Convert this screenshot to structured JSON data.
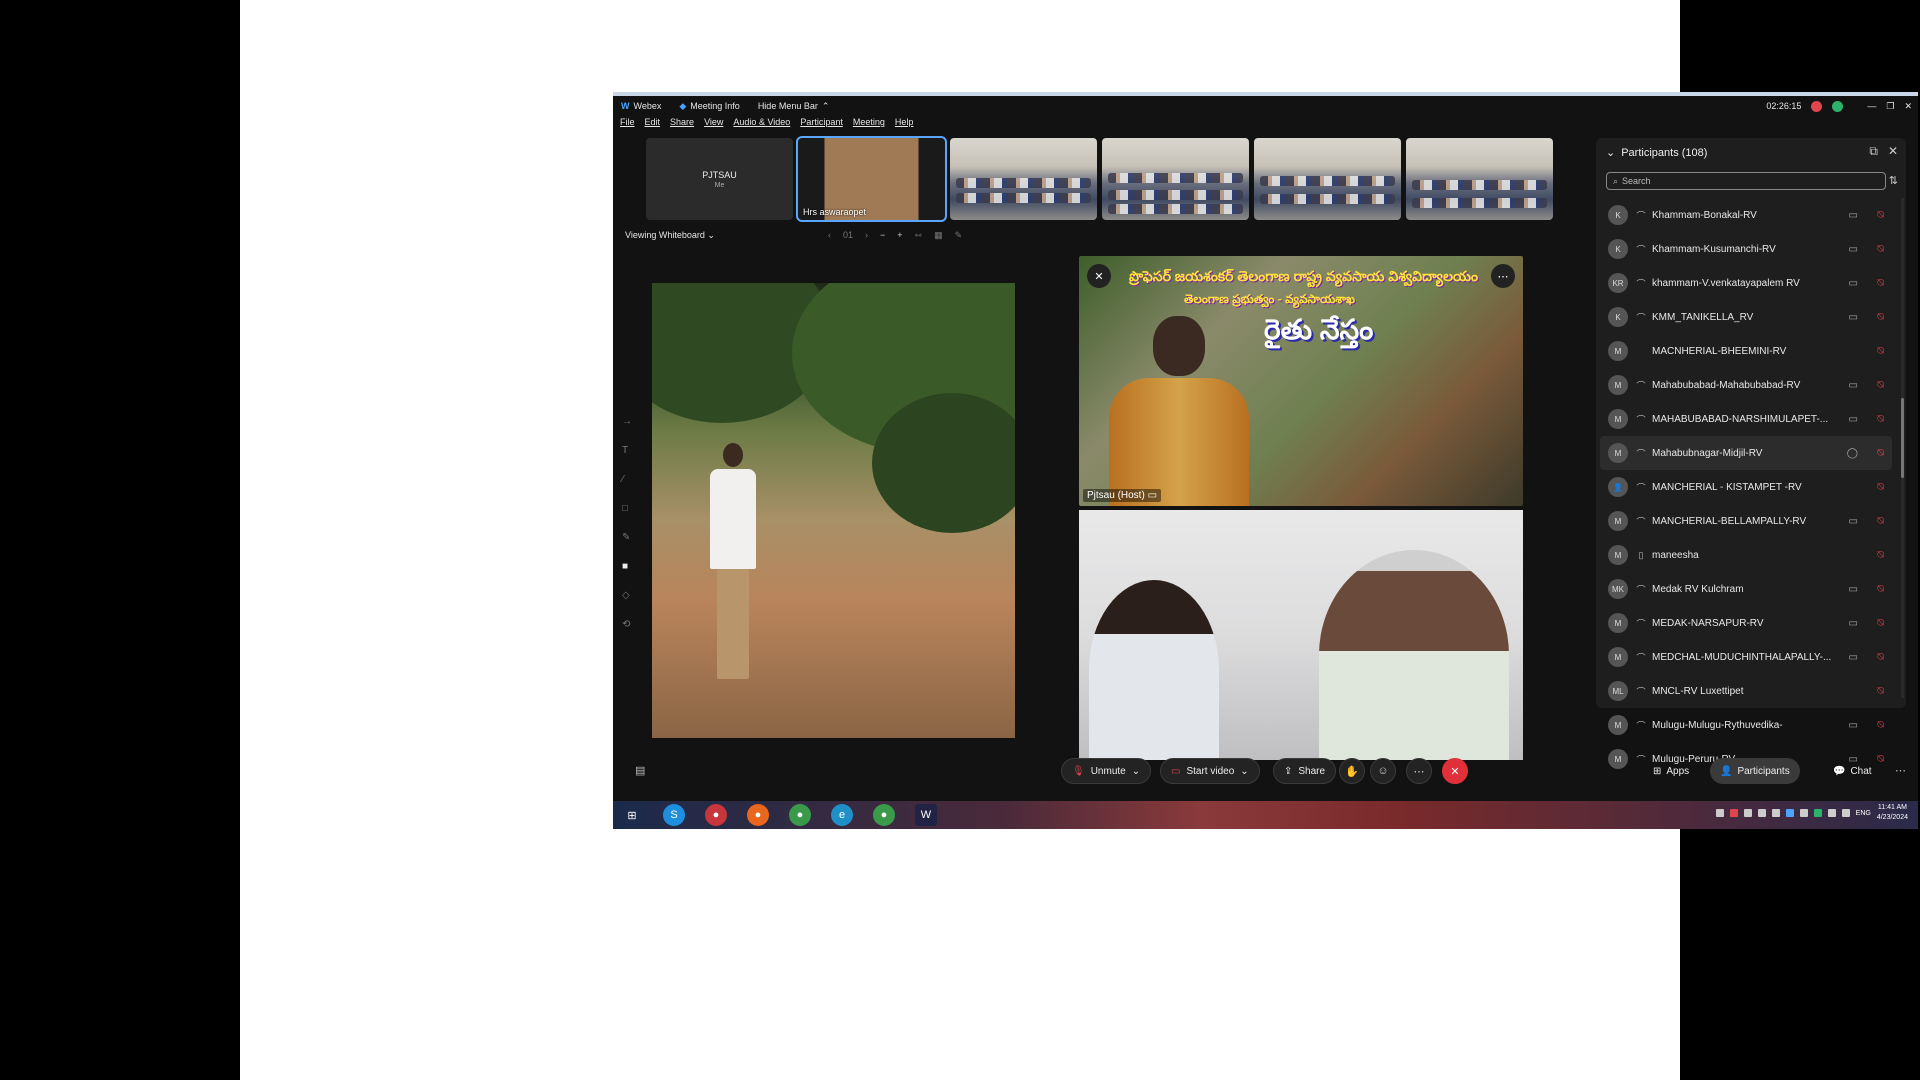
{
  "window": {
    "app_name": "Webex",
    "meeting_info": "Meeting Info",
    "hide_menu": "Hide Menu Bar",
    "timer": "02:26:15"
  },
  "menu": [
    "File",
    "Edit",
    "Share",
    "View",
    "Audio & Video",
    "Participant",
    "Meeting",
    "Help"
  ],
  "thumbnails": {
    "me_name": "PJTSAU",
    "me_label": "Me",
    "active_name": "Hrs aswaraopet"
  },
  "viewbar": {
    "label": "Viewing Whiteboard",
    "page": "01"
  },
  "banner": {
    "line1": "ప్రొఫెసర్ జయశంకర్ తెలంగాణ రాష్ట్ర వ్యవసాయ విశ్వవిద్యాలయం",
    "line2": "తెలంగాణ ప్రభుత్వం - వ్యవసాయశాఖ",
    "title": "రైతు నేస్తం",
    "host_label": "Pjtsau (Host)"
  },
  "participants": {
    "title": "Participants (108)",
    "search_placeholder": "Search",
    "list": [
      {
        "initials": "K",
        "name": "Khammam-Bonakal-RV",
        "cam": true
      },
      {
        "initials": "K",
        "name": "Khammam-Kusumanchi-RV",
        "cam": true
      },
      {
        "initials": "KR",
        "name": "khammam-V.venkatayapalem RV",
        "cam": true
      },
      {
        "initials": "K",
        "name": "KMM_TANIKELLA_RV",
        "cam": true
      },
      {
        "initials": "M",
        "name": "MACNHERIAL-BHEEMINI-RV",
        "cam": false
      },
      {
        "initials": "M",
        "name": "Mahabubabad-Mahabubabad-RV",
        "cam": true
      },
      {
        "initials": "M",
        "name": "MAHABUBABAD-NARSHIMULAPET-...",
        "cam": true
      },
      {
        "initials": "M",
        "name": "Mahabubnagar-Midjil-RV",
        "cam": true
      },
      {
        "initials": "",
        "name": "MANCHERIAL - KISTAMPET -RV",
        "cam": false
      },
      {
        "initials": "M",
        "name": "MANCHERIAL-BELLAMPALLY-RV",
        "cam": true
      },
      {
        "initials": "M",
        "name": "maneesha",
        "cam": false
      },
      {
        "initials": "MK",
        "name": "Medak RV Kulchram",
        "cam": true
      },
      {
        "initials": "M",
        "name": "MEDAK-NARSAPUR-RV",
        "cam": true
      },
      {
        "initials": "M",
        "name": "MEDCHAL-MUDUCHINTHALAPALLY-...",
        "cam": true
      },
      {
        "initials": "ML",
        "name": "MNCL-RV Luxettipet",
        "cam": false
      },
      {
        "initials": "M",
        "name": "Mulugu-Mulugu-Rythuvedika-",
        "cam": true
      },
      {
        "initials": "M",
        "name": "Mulugu-Peruru-RV",
        "cam": true
      }
    ]
  },
  "controls": {
    "unmute": "Unmute",
    "start_video": "Start video",
    "share": "Share",
    "apps": "Apps",
    "participants": "Participants",
    "chat": "Chat"
  },
  "taskbar": {
    "lang": "ENG",
    "time": "11:41 AM",
    "date": "4/23/2024"
  }
}
